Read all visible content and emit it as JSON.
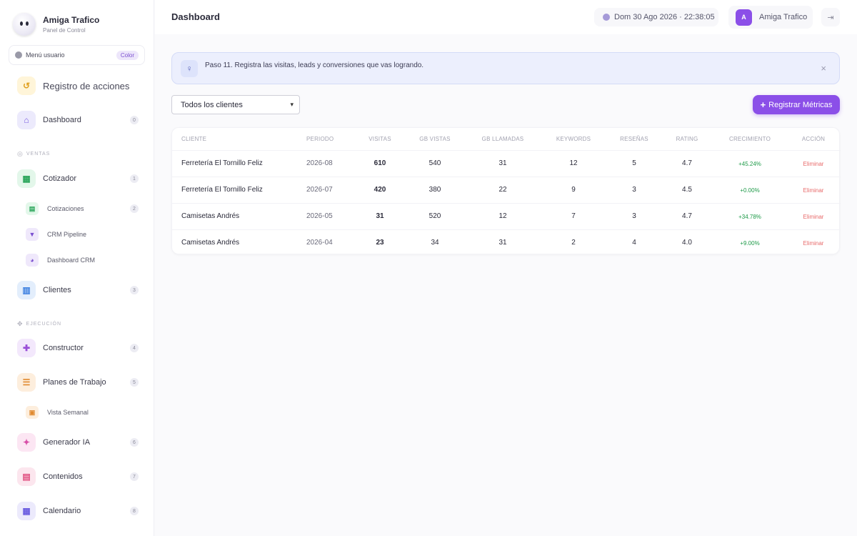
{
  "brand": {
    "title": "Amiga Trafico",
    "subtitle": "Panel de Control"
  },
  "user_menu": {
    "label": "Menú usuario",
    "badge": "Color"
  },
  "nav": {
    "registro": "Registro de acciones",
    "dashboard": {
      "label": "Dashboard",
      "count": "0"
    },
    "section_ventas": "VENTAS",
    "cotizador": {
      "label": "Cotizador",
      "count": "1"
    },
    "cotizaciones": {
      "label": "Cotizaciones",
      "count": "2"
    },
    "crm_pipeline": {
      "label": "CRM Pipeline"
    },
    "dashboard_crm": {
      "label": "Dashboard CRM"
    },
    "clientes": {
      "label": "Clientes",
      "count": "3"
    },
    "section_ejecucion": "EJECUCIÓN",
    "constructor": {
      "label": "Constructor",
      "count": "4"
    },
    "planes": {
      "label": "Planes de Trabajo",
      "count": "5"
    },
    "vista_semanal": {
      "label": "Vista Semanal"
    },
    "generador": {
      "label": "Generador IA",
      "count": "6"
    },
    "contenidos": {
      "label": "Contenidos",
      "count": "7"
    },
    "calendario": {
      "label": "Calendario",
      "count": "8"
    }
  },
  "header": {
    "title": "Dashboard",
    "datetime": "Dom 30 Ago 2026 · 22:38:05",
    "user_initial": "A",
    "user_name": "Amiga Trafico"
  },
  "alert": {
    "message": "Paso 11. Registra las visitas, leads y conversiones que vas logrando."
  },
  "filters": {
    "client_select": "Todos los clientes",
    "register_button": "Registrar Métricas"
  },
  "table": {
    "headers": {
      "cliente": "CLIENTE",
      "periodo": "PERIODO",
      "visitas": "VISITAS",
      "gb_vistas": "GB VISTAS",
      "gb_llamadas": "GB LLAMADAS",
      "keywords": "KEYWORDS",
      "resenas": "RESEÑAS",
      "rating": "RATING",
      "crecimiento": "CRECIMIENTO",
      "accion": "ACCIÓN"
    },
    "rows": [
      {
        "cliente": "Ferretería El Tornillo Feliz",
        "periodo": "2026-08",
        "visitas": "610",
        "gb_vistas": "540",
        "gb_llamadas": "31",
        "keywords": "12",
        "resenas": "5",
        "rating": "4.7",
        "crecimiento": "+45.24%",
        "accion": "Eliminar"
      },
      {
        "cliente": "Ferretería El Tornillo Feliz",
        "periodo": "2026-07",
        "visitas": "420",
        "gb_vistas": "380",
        "gb_llamadas": "22",
        "keywords": "9",
        "resenas": "3",
        "rating": "4.5",
        "crecimiento": "+0.00%",
        "accion": "Eliminar"
      },
      {
        "cliente": "Camisetas Andrés",
        "periodo": "2026-05",
        "visitas": "31",
        "gb_vistas": "520",
        "gb_llamadas": "12",
        "keywords": "7",
        "resenas": "3",
        "rating": "4.7",
        "crecimiento": "+34.78%",
        "accion": "Eliminar"
      },
      {
        "cliente": "Camisetas Andrés",
        "periodo": "2026-04",
        "visitas": "23",
        "gb_vistas": "34",
        "gb_llamadas": "31",
        "keywords": "2",
        "resenas": "4",
        "rating": "4.0",
        "crecimiento": "+9.00%",
        "accion": "Eliminar"
      }
    ]
  },
  "colors": {
    "accent": "#8b4fe8",
    "growth": "#1e9a48",
    "danger": "#e86a6a",
    "alert_bg": "#eceffd"
  }
}
